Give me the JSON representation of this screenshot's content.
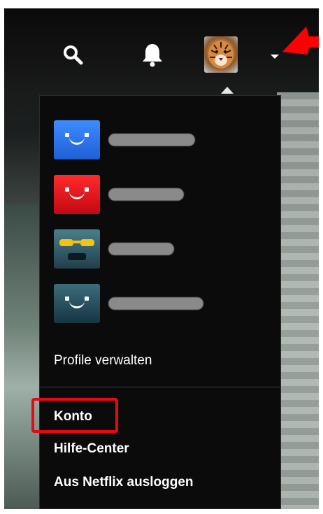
{
  "header": {
    "search_icon": "search-icon",
    "notifications_icon": "bell-icon",
    "profile_avatar": "tiger-avatar",
    "dropdown_caret": "caret-down-icon",
    "annotation_arrow_color": "#e50914"
  },
  "profiles": [
    {
      "avatar_color": "#1a73e8",
      "name": ""
    },
    {
      "avatar_color": "#e50914",
      "name": ""
    },
    {
      "avatar_color": "#2f5a6a",
      "name": ""
    },
    {
      "avatar_color": "#1c4a5a",
      "name": ""
    }
  ],
  "menu": {
    "manage_profiles_label": "Profile verwalten",
    "account_label": "Konto",
    "help_center_label": "Hilfe-Center",
    "sign_out_label": "Aus Netflix ausloggen",
    "highlight_color": "#e50914"
  }
}
